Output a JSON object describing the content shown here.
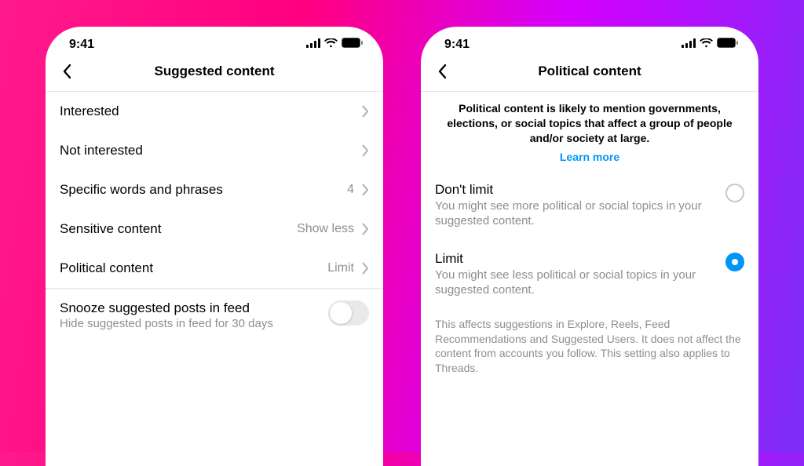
{
  "status": {
    "time": "9:41"
  },
  "left": {
    "title": "Suggested content",
    "rows": [
      {
        "label": "Interested",
        "value": ""
      },
      {
        "label": "Not interested",
        "value": ""
      },
      {
        "label": "Specific words and phrases",
        "value": "4"
      },
      {
        "label": "Sensitive content",
        "value": "Show less"
      },
      {
        "label": "Political content",
        "value": "Limit"
      }
    ],
    "snooze": {
      "label": "Snooze suggested posts in feed",
      "sub": "Hide suggested posts in feed for 30 days",
      "on": false
    }
  },
  "right": {
    "title": "Political content",
    "description": "Political content is likely to mention governments, elections, or social topics that affect a group of people and/or society at large.",
    "learn_more": "Learn more",
    "options": [
      {
        "label": "Don't limit",
        "sub": "You might see more political or social topics in your suggested content.",
        "selected": false
      },
      {
        "label": "Limit",
        "sub": "You might see less political or social topics in your suggested content.",
        "selected": true
      }
    ],
    "footnote": "This affects suggestions in Explore, Reels, Feed Recommendations and Suggested Users. It does not affect the content from accounts you follow. This setting also applies to Threads."
  }
}
